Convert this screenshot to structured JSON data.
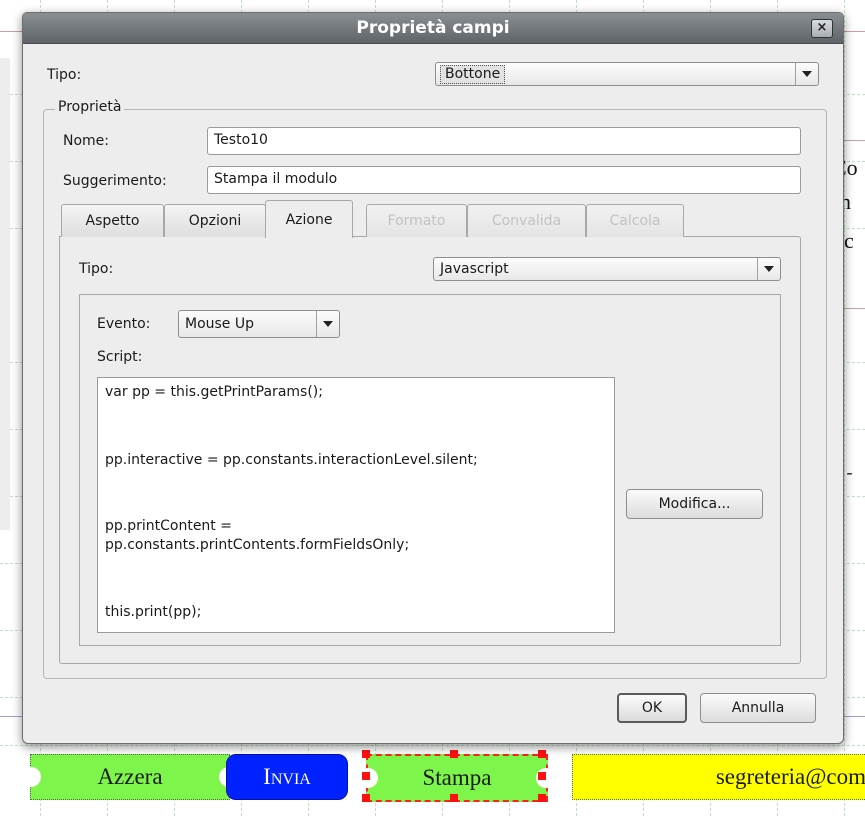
{
  "background": {
    "form_buttons": {
      "azzera": "Azzera",
      "invia": "Invia",
      "stampa": "Stampa",
      "email": "segreteria@com"
    },
    "right_fragments": [
      "Co",
      "n",
      "c",
      "- -"
    ]
  },
  "dialog": {
    "title": "Proprietà campi",
    "close_label": "×",
    "tipo_label": "Tipo:",
    "tipo_value": "Bottone",
    "properties_legend": "Proprietà",
    "nome_label": "Nome:",
    "nome_value": "Testo10",
    "suggerimento_label": "Suggerimento:",
    "suggerimento_value": "Stampa il modulo",
    "tabs": [
      "Aspetto",
      "Opzioni",
      "Azione",
      "Formato",
      "Convalida",
      "Calcola"
    ],
    "azione": {
      "tipo_label": "Tipo:",
      "tipo_value": "Javascript",
      "evento_label": "Evento:",
      "evento_value": "Mouse Up",
      "script_label": "Script:",
      "script_lines": [
        "var pp = this.getPrintParams();",
        "pp.interactive = pp.constants.interactionLevel.silent;",
        "pp.printContent =",
        "pp.constants.printContents.formFieldsOnly;",
        "this.print(pp);"
      ],
      "modifica_label": "Modifica..."
    },
    "ok_label": "OK",
    "annulla_label": "Annulla"
  }
}
